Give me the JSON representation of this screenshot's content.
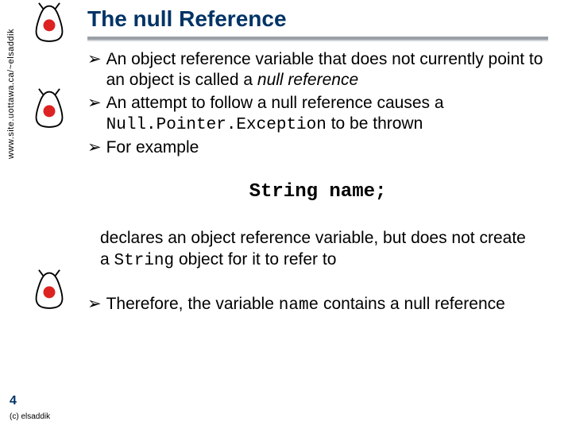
{
  "sidebar": {
    "url": "www.site.uottawa.ca/~elsaddik"
  },
  "title": "The null Reference",
  "bullets": {
    "b1_pre": "An object reference variable that does not currently point to an object is called a ",
    "b1_em": "null reference",
    "b2_pre": "An attempt to follow a null reference causes a ",
    "b2_code": "Null.Pointer.Exception",
    "b2_post": " to be thrown",
    "b3": "For example"
  },
  "example": "String name;",
  "para": {
    "pre": "declares an object reference variable, but does not create a ",
    "code": "String",
    "post": " object for it to refer to"
  },
  "bullet4": {
    "pre": "Therefore, the variable ",
    "code": "name",
    "post": " contains a null reference"
  },
  "slide_number": "4",
  "credit": "(c) elsaddik",
  "glyphs": {
    "arrow": "➢"
  }
}
